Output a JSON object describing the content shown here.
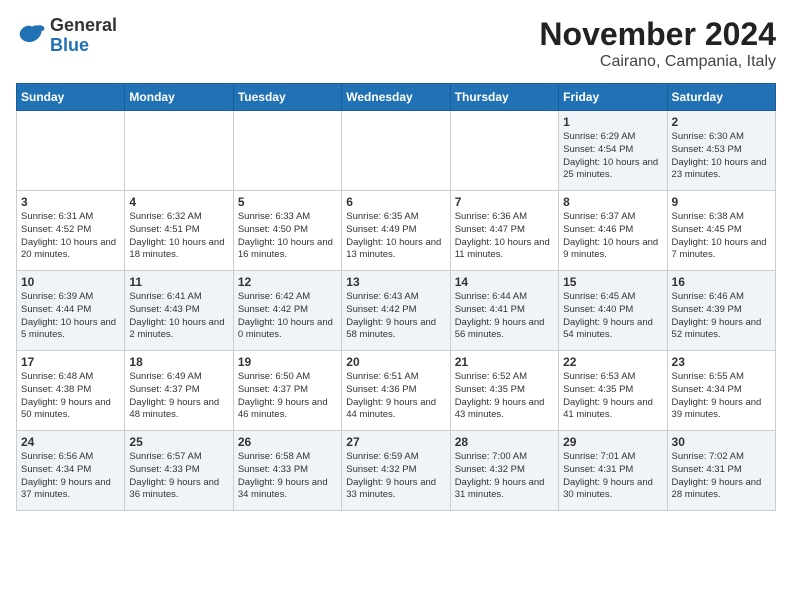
{
  "logo": {
    "line1": "General",
    "line2": "Blue"
  },
  "title": "November 2024",
  "location": "Cairano, Campania, Italy",
  "weekdays": [
    "Sunday",
    "Monday",
    "Tuesday",
    "Wednesday",
    "Thursday",
    "Friday",
    "Saturday"
  ],
  "weeks": [
    [
      {
        "day": "",
        "info": ""
      },
      {
        "day": "",
        "info": ""
      },
      {
        "day": "",
        "info": ""
      },
      {
        "day": "",
        "info": ""
      },
      {
        "day": "",
        "info": ""
      },
      {
        "day": "1",
        "info": "Sunrise: 6:29 AM\nSunset: 4:54 PM\nDaylight: 10 hours\nand 25 minutes."
      },
      {
        "day": "2",
        "info": "Sunrise: 6:30 AM\nSunset: 4:53 PM\nDaylight: 10 hours\nand 23 minutes."
      }
    ],
    [
      {
        "day": "3",
        "info": "Sunrise: 6:31 AM\nSunset: 4:52 PM\nDaylight: 10 hours\nand 20 minutes."
      },
      {
        "day": "4",
        "info": "Sunrise: 6:32 AM\nSunset: 4:51 PM\nDaylight: 10 hours\nand 18 minutes."
      },
      {
        "day": "5",
        "info": "Sunrise: 6:33 AM\nSunset: 4:50 PM\nDaylight: 10 hours\nand 16 minutes."
      },
      {
        "day": "6",
        "info": "Sunrise: 6:35 AM\nSunset: 4:49 PM\nDaylight: 10 hours\nand 13 minutes."
      },
      {
        "day": "7",
        "info": "Sunrise: 6:36 AM\nSunset: 4:47 PM\nDaylight: 10 hours\nand 11 minutes."
      },
      {
        "day": "8",
        "info": "Sunrise: 6:37 AM\nSunset: 4:46 PM\nDaylight: 10 hours\nand 9 minutes."
      },
      {
        "day": "9",
        "info": "Sunrise: 6:38 AM\nSunset: 4:45 PM\nDaylight: 10 hours\nand 7 minutes."
      }
    ],
    [
      {
        "day": "10",
        "info": "Sunrise: 6:39 AM\nSunset: 4:44 PM\nDaylight: 10 hours\nand 5 minutes."
      },
      {
        "day": "11",
        "info": "Sunrise: 6:41 AM\nSunset: 4:43 PM\nDaylight: 10 hours\nand 2 minutes."
      },
      {
        "day": "12",
        "info": "Sunrise: 6:42 AM\nSunset: 4:42 PM\nDaylight: 10 hours\nand 0 minutes."
      },
      {
        "day": "13",
        "info": "Sunrise: 6:43 AM\nSunset: 4:42 PM\nDaylight: 9 hours\nand 58 minutes."
      },
      {
        "day": "14",
        "info": "Sunrise: 6:44 AM\nSunset: 4:41 PM\nDaylight: 9 hours\nand 56 minutes."
      },
      {
        "day": "15",
        "info": "Sunrise: 6:45 AM\nSunset: 4:40 PM\nDaylight: 9 hours\nand 54 minutes."
      },
      {
        "day": "16",
        "info": "Sunrise: 6:46 AM\nSunset: 4:39 PM\nDaylight: 9 hours\nand 52 minutes."
      }
    ],
    [
      {
        "day": "17",
        "info": "Sunrise: 6:48 AM\nSunset: 4:38 PM\nDaylight: 9 hours\nand 50 minutes."
      },
      {
        "day": "18",
        "info": "Sunrise: 6:49 AM\nSunset: 4:37 PM\nDaylight: 9 hours\nand 48 minutes."
      },
      {
        "day": "19",
        "info": "Sunrise: 6:50 AM\nSunset: 4:37 PM\nDaylight: 9 hours\nand 46 minutes."
      },
      {
        "day": "20",
        "info": "Sunrise: 6:51 AM\nSunset: 4:36 PM\nDaylight: 9 hours\nand 44 minutes."
      },
      {
        "day": "21",
        "info": "Sunrise: 6:52 AM\nSunset: 4:35 PM\nDaylight: 9 hours\nand 43 minutes."
      },
      {
        "day": "22",
        "info": "Sunrise: 6:53 AM\nSunset: 4:35 PM\nDaylight: 9 hours\nand 41 minutes."
      },
      {
        "day": "23",
        "info": "Sunrise: 6:55 AM\nSunset: 4:34 PM\nDaylight: 9 hours\nand 39 minutes."
      }
    ],
    [
      {
        "day": "24",
        "info": "Sunrise: 6:56 AM\nSunset: 4:34 PM\nDaylight: 9 hours\nand 37 minutes."
      },
      {
        "day": "25",
        "info": "Sunrise: 6:57 AM\nSunset: 4:33 PM\nDaylight: 9 hours\nand 36 minutes."
      },
      {
        "day": "26",
        "info": "Sunrise: 6:58 AM\nSunset: 4:33 PM\nDaylight: 9 hours\nand 34 minutes."
      },
      {
        "day": "27",
        "info": "Sunrise: 6:59 AM\nSunset: 4:32 PM\nDaylight: 9 hours\nand 33 minutes."
      },
      {
        "day": "28",
        "info": "Sunrise: 7:00 AM\nSunset: 4:32 PM\nDaylight: 9 hours\nand 31 minutes."
      },
      {
        "day": "29",
        "info": "Sunrise: 7:01 AM\nSunset: 4:31 PM\nDaylight: 9 hours\nand 30 minutes."
      },
      {
        "day": "30",
        "info": "Sunrise: 7:02 AM\nSunset: 4:31 PM\nDaylight: 9 hours\nand 28 minutes."
      }
    ]
  ]
}
